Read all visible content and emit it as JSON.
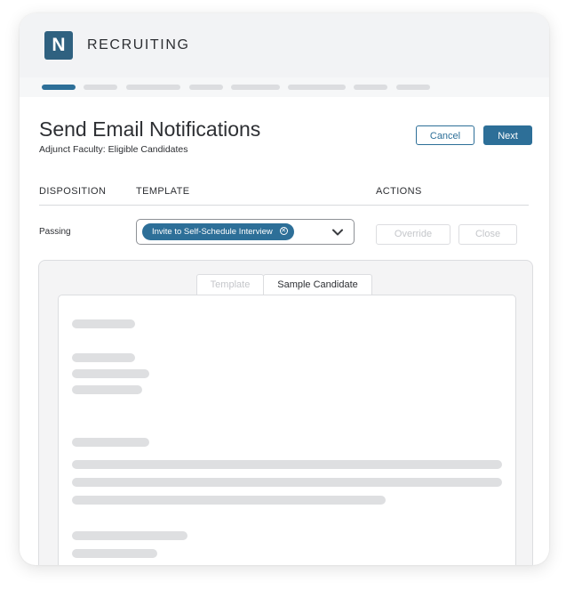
{
  "app": {
    "logo_letter": "N",
    "title": "RECRUITING"
  },
  "progress": {
    "total_steps": 8,
    "current_step": 1
  },
  "page": {
    "title": "Send Email Notifications",
    "subtitle": "Adjunct Faculty: Eligible Candidates"
  },
  "actions": {
    "cancel_label": "Cancel",
    "next_label": "Next"
  },
  "table": {
    "columns": [
      "DISPOSITION",
      "TEMPLATE",
      "ACTIONS"
    ],
    "rows": [
      {
        "disposition": "Passing",
        "template_chip": "Invite to Self-Schedule Interview",
        "chip_remove_glyph": "✕",
        "override_label": "Override",
        "close_label": "Close"
      }
    ]
  },
  "preview": {
    "tabs": [
      {
        "label": "Template",
        "active": false
      },
      {
        "label": "Sample Candidate",
        "active": true
      }
    ]
  },
  "colors": {
    "accent": "#2d6f98",
    "logo": "#2f6180",
    "skeleton": "#dedfe1"
  }
}
